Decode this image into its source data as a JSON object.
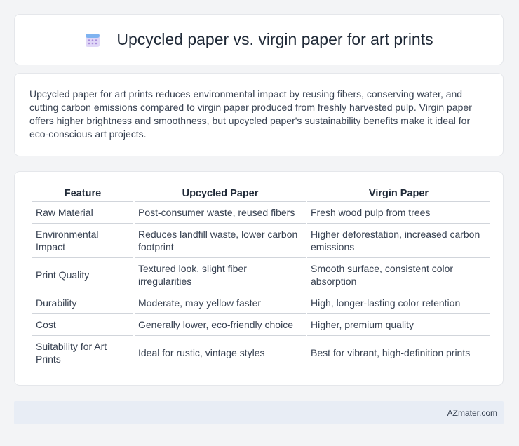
{
  "header": {
    "title": "Upcycled paper vs. virgin paper for art prints",
    "icon": "calendar-icon"
  },
  "intro": {
    "text": "Upcycled paper for art prints reduces environmental impact by reusing fibers, conserving water, and cutting carbon emissions compared to virgin paper produced from freshly harvested pulp. Virgin paper offers higher brightness and smoothness, but upcycled paper's sustainability benefits make it ideal for eco-conscious art projects."
  },
  "table": {
    "headers": [
      "Feature",
      "Upcycled Paper",
      "Virgin Paper"
    ],
    "rows": [
      [
        "Raw Material",
        "Post-consumer waste, reused fibers",
        "Fresh wood pulp from trees"
      ],
      [
        "Environmental Impact",
        "Reduces landfill waste, lower carbon footprint",
        "Higher deforestation, increased carbon emissions"
      ],
      [
        "Print Quality",
        "Textured look, slight fiber irregularities",
        "Smooth surface, consistent color absorption"
      ],
      [
        "Durability",
        "Moderate, may yellow faster",
        "High, longer-lasting color retention"
      ],
      [
        "Cost",
        "Generally lower, eco-friendly choice",
        "Higher, premium quality"
      ],
      [
        "Suitability for Art Prints",
        "Ideal for rustic, vintage styles",
        "Best for vibrant, high-definition prints"
      ]
    ]
  },
  "footer": {
    "brand": "AZmater.com"
  }
}
